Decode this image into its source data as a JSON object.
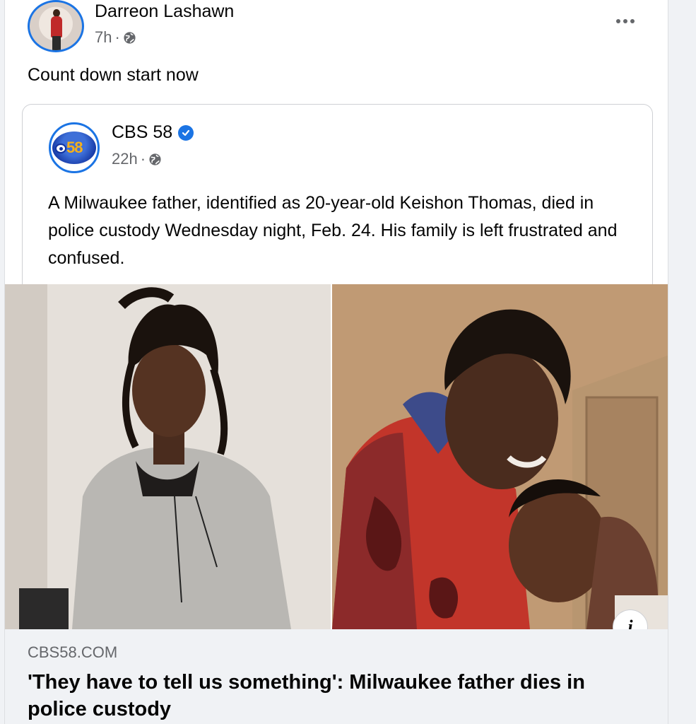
{
  "post": {
    "author": "Darreon Lashawn",
    "time": "7h",
    "separator": "·",
    "text": "Count down start now"
  },
  "shared_post": {
    "page_name": "CBS 58",
    "logo_text": "58",
    "time": "22h",
    "separator": "·",
    "text": "A Milwaukee father, identified as 20-year-old Keishon Thomas, died in police custody Wednesday night, Feb. 24. His family is left frustrated and confused."
  },
  "link_preview": {
    "domain": "CBS58.COM",
    "title": "'They have to tell us something': Milwaukee father dies in police custody"
  },
  "icons": {
    "more": "more-options-icon",
    "privacy": "globe-icon",
    "verified": "verified-badge-icon",
    "info": "info-icon",
    "info_glyph": "i"
  },
  "colors": {
    "accent": "#1b74e4",
    "secondary_text": "#65676b",
    "background": "#f0f2f5"
  }
}
